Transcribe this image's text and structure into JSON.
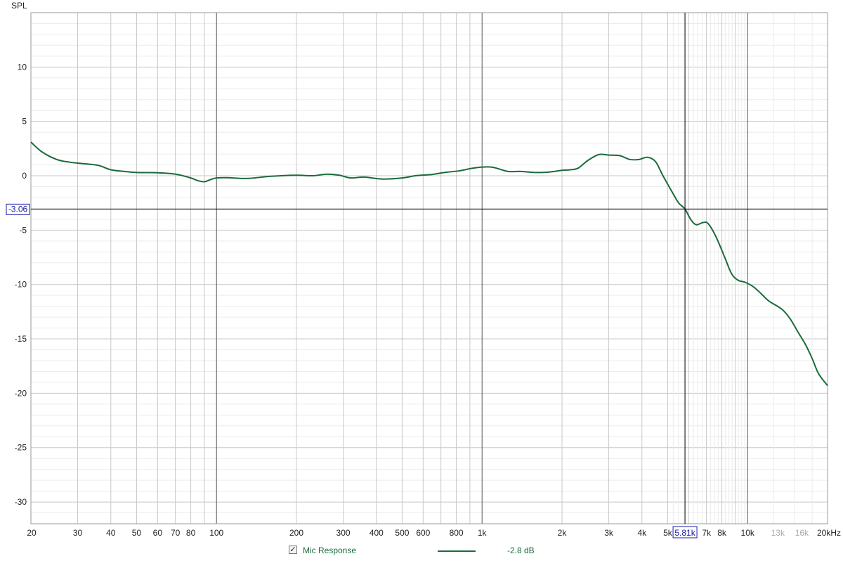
{
  "chart_data": {
    "type": "line",
    "ylabel": "SPL",
    "x_scale": "log",
    "xlim": [
      20,
      20000
    ],
    "ylim": [
      -32,
      15
    ],
    "grid": true,
    "y_ticks": [
      10,
      5,
      0,
      -5,
      -10,
      -15,
      -20,
      -25,
      -30
    ],
    "x_tick_labels": [
      {
        "f": 20,
        "label": "20"
      },
      {
        "f": 30,
        "label": "30"
      },
      {
        "f": 40,
        "label": "40"
      },
      {
        "f": 50,
        "label": "50"
      },
      {
        "f": 60,
        "label": "60"
      },
      {
        "f": 70,
        "label": "70"
      },
      {
        "f": 80,
        "label": "80"
      },
      {
        "f": 100,
        "label": "100"
      },
      {
        "f": 200,
        "label": "200"
      },
      {
        "f": 300,
        "label": "300"
      },
      {
        "f": 400,
        "label": "400"
      },
      {
        "f": 500,
        "label": "500"
      },
      {
        "f": 600,
        "label": "600"
      },
      {
        "f": 800,
        "label": "800"
      },
      {
        "f": 1000,
        "label": "1k"
      },
      {
        "f": 2000,
        "label": "2k"
      },
      {
        "f": 3000,
        "label": "3k"
      },
      {
        "f": 4000,
        "label": "4k"
      },
      {
        "f": 5000,
        "label": "5k"
      },
      {
        "f": 7000,
        "label": "7k"
      },
      {
        "f": 8000,
        "label": "8k"
      },
      {
        "f": 10000,
        "label": "10k"
      },
      {
        "f": 13000,
        "label": "13k",
        "dim": true
      },
      {
        "f": 16000,
        "label": "16k",
        "dim": true
      },
      {
        "f": 20000,
        "label": "20kHz"
      }
    ],
    "cursor": {
      "x": 5810,
      "x_label": "5.81k",
      "y": -3.06,
      "y_label": "-3.06"
    },
    "series": [
      {
        "name": "Mic Response",
        "color": "#1a6b3a",
        "points": [
          [
            20,
            3.1
          ],
          [
            22,
            2.2
          ],
          [
            25,
            1.5
          ],
          [
            28,
            1.25
          ],
          [
            32,
            1.1
          ],
          [
            36,
            0.95
          ],
          [
            40,
            0.55
          ],
          [
            45,
            0.4
          ],
          [
            50,
            0.3
          ],
          [
            60,
            0.28
          ],
          [
            70,
            0.15
          ],
          [
            80,
            -0.2
          ],
          [
            85,
            -0.45
          ],
          [
            90,
            -0.55
          ],
          [
            95,
            -0.35
          ],
          [
            100,
            -0.2
          ],
          [
            110,
            -0.18
          ],
          [
            130,
            -0.25
          ],
          [
            160,
            -0.05
          ],
          [
            200,
            0.05
          ],
          [
            230,
            0.0
          ],
          [
            260,
            0.15
          ],
          [
            290,
            0.05
          ],
          [
            320,
            -0.2
          ],
          [
            360,
            -0.12
          ],
          [
            420,
            -0.3
          ],
          [
            500,
            -0.2
          ],
          [
            560,
            0.0
          ],
          [
            650,
            0.12
          ],
          [
            720,
            0.3
          ],
          [
            820,
            0.45
          ],
          [
            900,
            0.65
          ],
          [
            1000,
            0.8
          ],
          [
            1100,
            0.78
          ],
          [
            1250,
            0.4
          ],
          [
            1400,
            0.4
          ],
          [
            1600,
            0.3
          ],
          [
            1800,
            0.35
          ],
          [
            2000,
            0.5
          ],
          [
            2150,
            0.55
          ],
          [
            2300,
            0.7
          ],
          [
            2500,
            1.4
          ],
          [
            2750,
            1.95
          ],
          [
            3000,
            1.9
          ],
          [
            3300,
            1.85
          ],
          [
            3600,
            1.5
          ],
          [
            3900,
            1.5
          ],
          [
            4200,
            1.7
          ],
          [
            4500,
            1.3
          ],
          [
            4800,
            0.0
          ],
          [
            5200,
            -1.5
          ],
          [
            5500,
            -2.5
          ],
          [
            5810,
            -3.06
          ],
          [
            6100,
            -4.0
          ],
          [
            6400,
            -4.5
          ],
          [
            6800,
            -4.3
          ],
          [
            7100,
            -4.4
          ],
          [
            7600,
            -5.6
          ],
          [
            8200,
            -7.5
          ],
          [
            8700,
            -9.0
          ],
          [
            9200,
            -9.6
          ],
          [
            9800,
            -9.8
          ],
          [
            10500,
            -10.2
          ],
          [
            11200,
            -10.8
          ],
          [
            12000,
            -11.5
          ],
          [
            13500,
            -12.3
          ],
          [
            14500,
            -13.2
          ],
          [
            15500,
            -14.4
          ],
          [
            16500,
            -15.5
          ],
          [
            17500,
            -16.8
          ],
          [
            18500,
            -18.2
          ],
          [
            20000,
            -19.3
          ]
        ]
      }
    ],
    "legend": {
      "checked": true,
      "check_glyph": "✓",
      "name": "Mic Response",
      "value": "-2.8 dB"
    }
  }
}
